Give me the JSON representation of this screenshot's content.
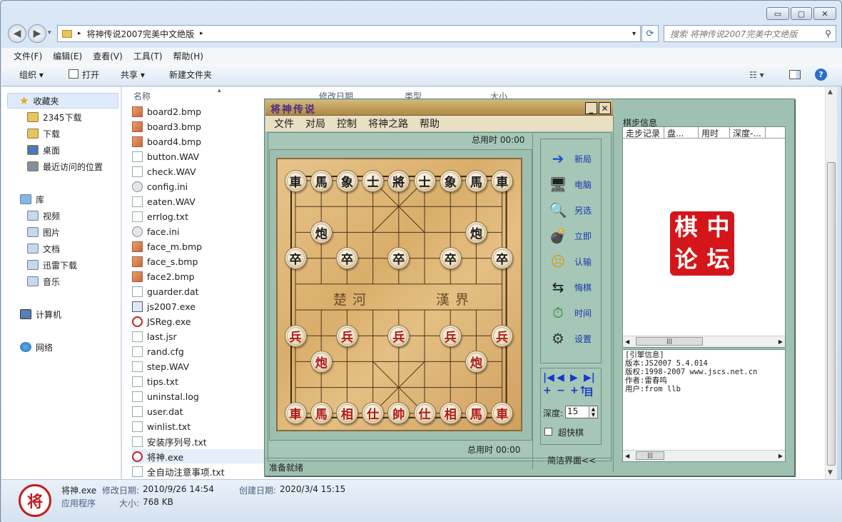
{
  "window": {
    "controls": {
      "minimize": "▭",
      "maximize": "▢",
      "close": "✕"
    }
  },
  "address": {
    "path": "将神传说2007完美中文绝版",
    "separator": "▸",
    "dropdown": "▾"
  },
  "search": {
    "placeholder": "搜索 将神传说2007完美中文绝版"
  },
  "menubar": [
    "文件(F)",
    "编辑(E)",
    "查看(V)",
    "工具(T)",
    "帮助(H)"
  ],
  "toolbar": {
    "organize": "组织 ▾",
    "open": "打开",
    "share": "共享 ▾",
    "new_folder": "新建文件夹"
  },
  "nav": {
    "favorites": "收藏夹",
    "fav_items": [
      "2345下载",
      "下载",
      "桌面",
      "最近访问的位置"
    ],
    "libraries": "库",
    "lib_items": [
      "视频",
      "图片",
      "文档",
      "迅雷下载",
      "音乐"
    ],
    "computer": "计算机",
    "network": "网络"
  },
  "columns": {
    "name": "名称",
    "modified": "修改日期",
    "type": "类型",
    "size": "大小"
  },
  "files": [
    {
      "name": "board2.bmp",
      "kind": "bmp"
    },
    {
      "name": "board3.bmp",
      "kind": "bmp"
    },
    {
      "name": "board4.bmp",
      "kind": "bmp"
    },
    {
      "name": "button.WAV",
      "kind": "file"
    },
    {
      "name": "check.WAV",
      "kind": "file"
    },
    {
      "name": "config.ini",
      "kind": "ini"
    },
    {
      "name": "eaten.WAV",
      "kind": "file"
    },
    {
      "name": "errlog.txt",
      "kind": "file"
    },
    {
      "name": "face.ini",
      "kind": "ini"
    },
    {
      "name": "face_m.bmp",
      "kind": "bmp"
    },
    {
      "name": "face_s.bmp",
      "kind": "bmp"
    },
    {
      "name": "face2.bmp",
      "kind": "bmp"
    },
    {
      "name": "guarder.dat",
      "kind": "file"
    },
    {
      "name": "js2007.exe",
      "kind": "exe"
    },
    {
      "name": "JSReg.exe",
      "kind": "js"
    },
    {
      "name": "last.jsr",
      "kind": "file"
    },
    {
      "name": "rand.cfg",
      "kind": "file"
    },
    {
      "name": "step.WAV",
      "kind": "file"
    },
    {
      "name": "tips.txt",
      "kind": "file"
    },
    {
      "name": "uninstal.log",
      "kind": "file"
    },
    {
      "name": "user.dat",
      "kind": "file"
    },
    {
      "name": "winlist.txt",
      "kind": "file"
    },
    {
      "name": "安装序列号.txt",
      "kind": "file"
    },
    {
      "name": "将神.exe",
      "kind": "js",
      "selected": true
    },
    {
      "name": "全自动注意事项.txt",
      "kind": "file"
    }
  ],
  "details": {
    "icon_char": "将",
    "name": "将神.exe",
    "modified_label": "修改日期:",
    "modified": "2010/9/26 14:54",
    "created_label": "创建日期:",
    "created": "2020/3/4 15:15",
    "type": "应用程序",
    "size_label": "大小:",
    "size": "768 KB"
  },
  "game": {
    "title": "将神传说",
    "min": "_",
    "close": "✕",
    "menu": [
      "文件",
      "对局",
      "控制",
      "将神之路",
      "帮助"
    ],
    "time_top": "总用时  00:00",
    "time_bottom": "总用时  00:00",
    "status": "准备就绪",
    "river_left": "楚河",
    "river_right": "漢界",
    "pieces": [
      {
        "c": "車",
        "s": "black",
        "f": 0,
        "r": 0
      },
      {
        "c": "馬",
        "s": "black",
        "f": 1,
        "r": 0
      },
      {
        "c": "象",
        "s": "black",
        "f": 2,
        "r": 0
      },
      {
        "c": "士",
        "s": "black",
        "f": 3,
        "r": 0
      },
      {
        "c": "將",
        "s": "black",
        "f": 4,
        "r": 0
      },
      {
        "c": "士",
        "s": "black",
        "f": 5,
        "r": 0
      },
      {
        "c": "象",
        "s": "black",
        "f": 6,
        "r": 0
      },
      {
        "c": "馬",
        "s": "black",
        "f": 7,
        "r": 0
      },
      {
        "c": "車",
        "s": "black",
        "f": 8,
        "r": 0
      },
      {
        "c": "炮",
        "s": "black",
        "f": 1,
        "r": 2
      },
      {
        "c": "炮",
        "s": "black",
        "f": 7,
        "r": 2
      },
      {
        "c": "卒",
        "s": "black",
        "f": 0,
        "r": 3
      },
      {
        "c": "卒",
        "s": "black",
        "f": 2,
        "r": 3
      },
      {
        "c": "卒",
        "s": "black",
        "f": 4,
        "r": 3
      },
      {
        "c": "卒",
        "s": "black",
        "f": 6,
        "r": 3
      },
      {
        "c": "卒",
        "s": "black",
        "f": 8,
        "r": 3
      },
      {
        "c": "兵",
        "s": "red",
        "f": 0,
        "r": 6
      },
      {
        "c": "兵",
        "s": "red",
        "f": 2,
        "r": 6
      },
      {
        "c": "兵",
        "s": "red",
        "f": 4,
        "r": 6
      },
      {
        "c": "兵",
        "s": "red",
        "f": 6,
        "r": 6
      },
      {
        "c": "兵",
        "s": "red",
        "f": 8,
        "r": 6
      },
      {
        "c": "炮",
        "s": "red",
        "f": 1,
        "r": 7
      },
      {
        "c": "炮",
        "s": "red",
        "f": 7,
        "r": 7
      },
      {
        "c": "車",
        "s": "red",
        "f": 0,
        "r": 9
      },
      {
        "c": "馬",
        "s": "red",
        "f": 1,
        "r": 9
      },
      {
        "c": "相",
        "s": "red",
        "f": 2,
        "r": 9
      },
      {
        "c": "仕",
        "s": "red",
        "f": 3,
        "r": 9
      },
      {
        "c": "帥",
        "s": "red",
        "f": 4,
        "r": 9
      },
      {
        "c": "仕",
        "s": "red",
        "f": 5,
        "r": 9
      },
      {
        "c": "相",
        "s": "red",
        "f": 6,
        "r": 9
      },
      {
        "c": "馬",
        "s": "red",
        "f": 7,
        "r": 9
      },
      {
        "c": "車",
        "s": "red",
        "f": 8,
        "r": 9
      }
    ],
    "actions": [
      {
        "label": "新局",
        "icon": "➔",
        "name": "new-game"
      },
      {
        "label": "电脑",
        "icon": "🖥",
        "name": "computer"
      },
      {
        "label": "另选",
        "icon": "🔍",
        "name": "reselect"
      },
      {
        "label": "立即",
        "icon": "💣",
        "name": "immediate"
      },
      {
        "label": "认输",
        "icon": "☹",
        "name": "resign"
      },
      {
        "label": "悔棋",
        "icon": "⇆",
        "name": "undo"
      },
      {
        "label": "时间",
        "icon": "⏱",
        "name": "time"
      },
      {
        "label": "设置",
        "icon": "⚙",
        "name": "settings"
      }
    ],
    "playback": [
      "|◀",
      "◀",
      "▶",
      "▶|",
      "+",
      "−",
      "+↑",
      "目"
    ],
    "depth_label": "深度:",
    "depth_value": "15",
    "fast_label": "超快棋",
    "simple_label": "简洁界面<<",
    "move_info_title": "棋步信息",
    "move_cols": [
      "走步记录",
      "盘...",
      "用时",
      "深度-..."
    ],
    "stamp": [
      "中",
      "棋",
      "坛",
      "论"
    ],
    "engine_lines": [
      "[引擎信息]",
      "版本:JS2007 5.4.014",
      "版权:1998-2007 www.jscs.net.cn",
      "作者:雷春鸣",
      "用户:from llb"
    ]
  }
}
